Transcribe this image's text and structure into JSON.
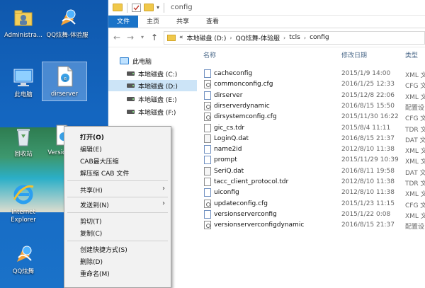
{
  "desktop": {
    "icons": [
      {
        "label": "Administra..."
      },
      {
        "label": "QQ炫舞-体验服"
      },
      {
        "label": "此电脑"
      },
      {
        "label": "dirserver"
      },
      {
        "label": "回收站"
      },
      {
        "label": "Versio rCo"
      },
      {
        "label": "Internet Explorer"
      },
      {
        "label": "QQ炫舞"
      }
    ]
  },
  "explorer": {
    "title": "config",
    "ribbon_tabs": [
      "文件",
      "主页",
      "共享",
      "查看"
    ],
    "address": {
      "prefix": "«",
      "segments": [
        "本地磁盘 (D:)",
        "QQ炫舞-体验服",
        "tcls",
        "config"
      ]
    },
    "nav": {
      "this_pc": "此电脑",
      "drives": [
        "本地磁盘 (C:)",
        "本地磁盘 (D:)",
        "本地磁盘 (E:)",
        "本地磁盘 (F:)"
      ]
    },
    "columns": {
      "name": "名称",
      "date": "修改日期",
      "type": "类型"
    },
    "files": [
      {
        "name": "cacheconfig",
        "date": "2015/1/9 14:00",
        "type": "XML 文",
        "icon": "xml"
      },
      {
        "name": "commonconfig.cfg",
        "date": "2016/1/25 12:33",
        "type": "CFG 文",
        "icon": "cfg"
      },
      {
        "name": "dirserver",
        "date": "2015/12/8 22:06",
        "type": "XML 文",
        "icon": "xml"
      },
      {
        "name": "dirserverdynamic",
        "date": "2016/8/15 15:50",
        "type": "配置设",
        "icon": "cfg"
      },
      {
        "name": "dirsystemconfig.cfg",
        "date": "2015/11/30 16:22",
        "type": "CFG 文",
        "icon": "cfg"
      },
      {
        "name": "gic_cs.tdr",
        "date": "2015/8/4 11:11",
        "type": "TDR 文",
        "icon": "doc"
      },
      {
        "name": "LoginQ.dat",
        "date": "2016/8/15 21:37",
        "type": "DAT 文",
        "icon": "dat"
      },
      {
        "name": "name2id",
        "date": "2012/8/10 11:38",
        "type": "XML 文",
        "icon": "xml"
      },
      {
        "name": "prompt",
        "date": "2015/11/29 10:39",
        "type": "XML 文",
        "icon": "xml"
      },
      {
        "name": "SeriQ.dat",
        "date": "2016/8/11 19:58",
        "type": "DAT 文",
        "icon": "dat"
      },
      {
        "name": "tacc_client_protocol.tdr",
        "date": "2012/8/10 11:38",
        "type": "TDR 文",
        "icon": "doc"
      },
      {
        "name": "uiconfig",
        "date": "2012/8/10 11:38",
        "type": "XML 文",
        "icon": "xml"
      },
      {
        "name": "updateconfig.cfg",
        "date": "2015/1/23 11:15",
        "type": "CFG 文",
        "icon": "cfg"
      },
      {
        "name": "versionserverconfig",
        "date": "2015/1/22 0:08",
        "type": "XML 文",
        "icon": "xml"
      },
      {
        "name": "versionserverconfigdynamic",
        "date": "2016/8/15 21:37",
        "type": "配置设",
        "icon": "cfg"
      }
    ]
  },
  "context_menu": {
    "items": [
      {
        "label": "打开(O)",
        "bold": true
      },
      {
        "label": "编辑(E)"
      },
      {
        "label": "CAB最大压缩"
      },
      {
        "label": "解压缩 CAB 文件"
      },
      {
        "label": "共享(H)",
        "submenu": true
      },
      {
        "label": "发送到(N)",
        "submenu": true
      },
      {
        "label": "剪切(T)"
      },
      {
        "label": "复制(C)"
      },
      {
        "label": "创建快捷方式(S)"
      },
      {
        "label": "删除(D)"
      },
      {
        "label": "重命名(M)"
      }
    ]
  },
  "colors": {
    "file_tab": "#1a73c8",
    "selection": "#cce4f7",
    "desktop": "#1763b4"
  }
}
